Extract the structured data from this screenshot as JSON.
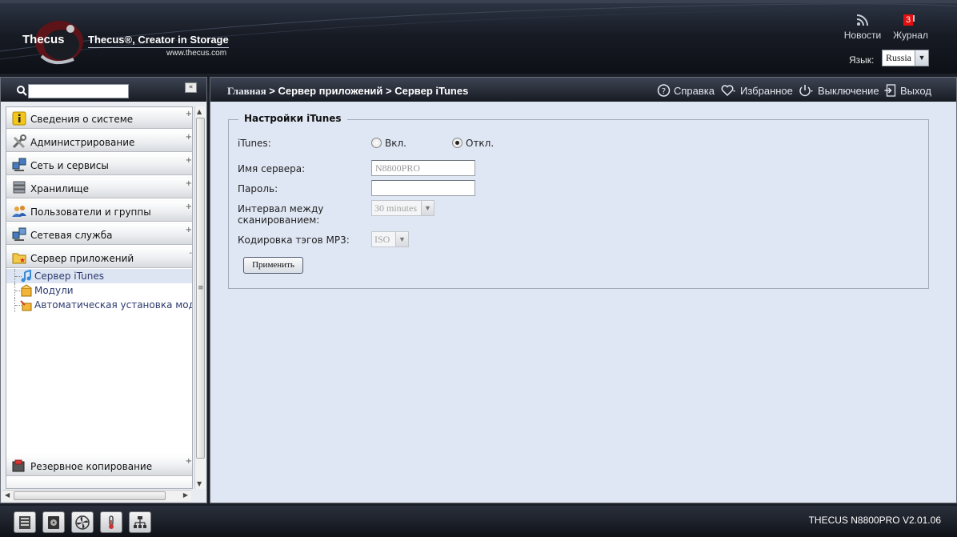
{
  "header": {
    "logo_text": "Thecus",
    "tagline": "Thecus®, Creator in Storage",
    "site": "www.thecus.com",
    "news_label": "Новости",
    "journal_label": "Журнал",
    "journal_badge": "3",
    "language_label": "Язык:",
    "language_value": "Russia"
  },
  "sidebar": {
    "search_placeholder": "",
    "collapse_glyph": "«",
    "categories": [
      {
        "label": "Сведения о системе",
        "icon": "info-icon",
        "state": "+"
      },
      {
        "label": "Администрирование",
        "icon": "tools-icon",
        "state": "+"
      },
      {
        "label": "Сеть и сервисы",
        "icon": "network-icon",
        "state": "+"
      },
      {
        "label": "Хранилище",
        "icon": "storage-icon",
        "state": "+"
      },
      {
        "label": "Пользователи и группы",
        "icon": "users-icon",
        "state": "+"
      },
      {
        "label": "Сетевая служба",
        "icon": "network-service-icon",
        "state": "+"
      },
      {
        "label": "Сервер приложений",
        "icon": "app-server-icon",
        "state": "-"
      },
      {
        "label": "Резервное копирование",
        "icon": "backup-icon",
        "state": "+"
      }
    ],
    "sub_items": [
      {
        "label": "Сервер iTunes",
        "icon": "itunes-icon",
        "selected": true
      },
      {
        "label": "Модули",
        "icon": "modules-icon",
        "selected": false
      },
      {
        "label": "Автоматическая установка модуле",
        "icon": "auto-install-icon",
        "selected": false
      }
    ]
  },
  "main": {
    "breadcrumb": {
      "home": "Главная",
      "sep1": " > ",
      "level2": "Сервер приложений",
      "sep2": " > ",
      "level3": "Сервер iTunes"
    },
    "toolbar": {
      "help": "Справка",
      "favorites": "Избранное",
      "power": "Выключение",
      "logout": "Выход"
    },
    "form": {
      "legend": "Настройки iTunes",
      "itunes_label": "iTunes:",
      "radio_on_label": "Вкл.",
      "radio_off_label": "Откл.",
      "radio_selected": "off",
      "server_name_label": "Имя сервера:",
      "server_name_value": "N8800PRO",
      "password_label": "Пароль:",
      "password_value": "",
      "scan_interval_label_line1": "Интервал между",
      "scan_interval_label_line2": "сканированием:",
      "scan_interval_value": "30 minutes",
      "mp3_encoding_label": "Кодировка тэгов MP3:",
      "mp3_encoding_value": "ISO",
      "apply_label": "Применить"
    }
  },
  "footer": {
    "model": "THECUS N8800PRO V2.01.06",
    "icons": [
      "server-icon",
      "disk-icon",
      "fan-icon",
      "thermometer-icon",
      "network-tree-icon"
    ]
  },
  "colors": {
    "header_bg": "#171b24",
    "content_bg": "#dfe7f4",
    "badge_red": "#e01010",
    "link_blue": "#2d3b6e"
  }
}
